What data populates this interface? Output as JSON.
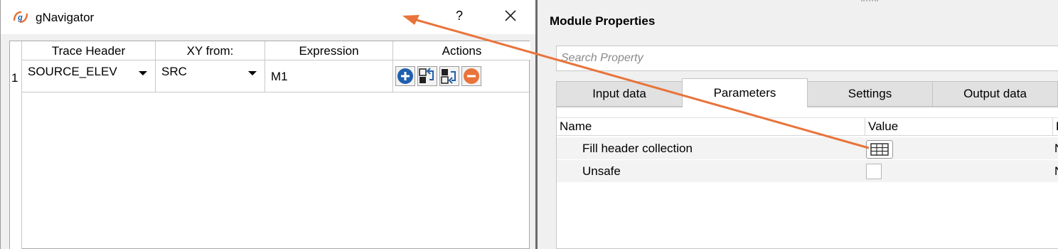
{
  "dialog": {
    "title": "gNavigator",
    "help_label": "?",
    "columns": [
      "Trace Header",
      "XY from:",
      "Expression",
      "Actions"
    ],
    "rows": [
      {
        "index": "1",
        "trace_header": "SOURCE_ELEV",
        "xy_from": "SRC",
        "expression": "M1"
      }
    ],
    "actions": [
      "add-icon",
      "swap-in-icon",
      "swap-out-icon",
      "remove-icon"
    ]
  },
  "module_properties": {
    "title": "Module Properties",
    "search_placeholder": "Search Property",
    "tabs": [
      "Input data",
      "Parameters",
      "Settings",
      "Output data"
    ],
    "active_tab": "Parameters",
    "grid_headers": [
      "Name",
      "Value",
      "F"
    ],
    "rows": [
      {
        "name": "Fill header collection",
        "value_type": "table-button",
        "extra": "N"
      },
      {
        "name": "Unsafe",
        "value_type": "checkbox",
        "extra": "N"
      }
    ]
  },
  "colors": {
    "annotation_arrow": "#e8743b",
    "action_blue": "#1f5fae",
    "action_orange": "#e8743b",
    "selected_tab": "#ffffff"
  }
}
